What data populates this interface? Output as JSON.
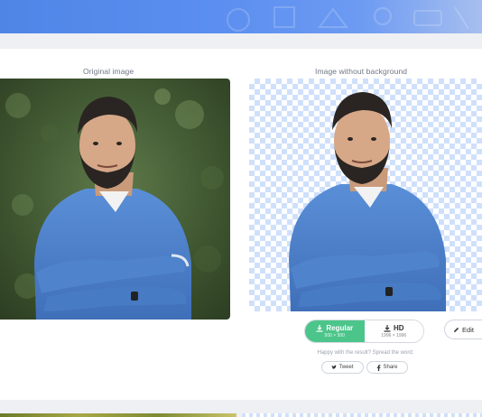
{
  "labels": {
    "original": "Original image",
    "without_background": "Image without background"
  },
  "download": {
    "regular_label": "Regular",
    "regular_size": "500 × 500",
    "hd_label": "HD",
    "hd_size": "1996 × 1996"
  },
  "edit_label": "Edit",
  "share": {
    "prompt": "Happy with the result? Spread the word:",
    "tweet_label": "Tweet",
    "facebook_label": "Share"
  },
  "colors": {
    "accent_green": "#4cc58a",
    "banner_blue": "#5b8ef0",
    "checker_blue": "#cfe0fb"
  }
}
